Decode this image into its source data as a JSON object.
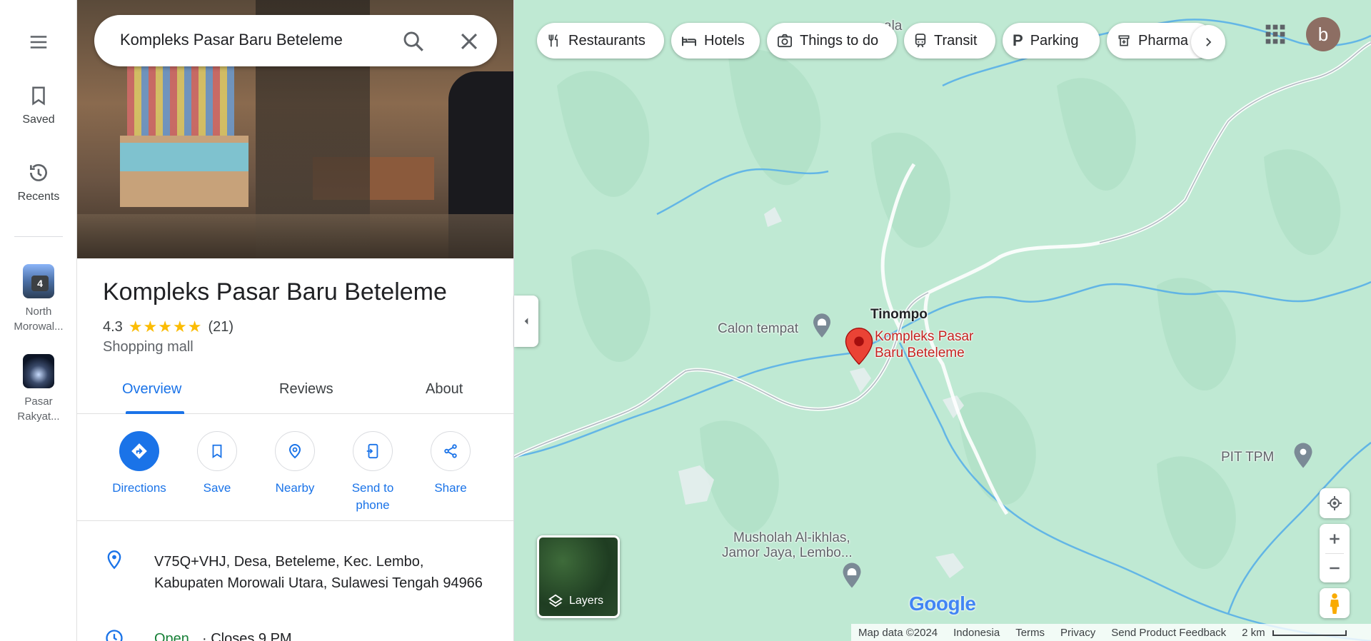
{
  "search": {
    "value": "Kompleks Pasar Baru Beteleme"
  },
  "rail": {
    "saved": "Saved",
    "recents": "Recents",
    "history": [
      {
        "label": "North Morowal...",
        "badge": "4"
      },
      {
        "label": "Pasar Rakyat..."
      }
    ]
  },
  "place": {
    "title": "Kompleks Pasar Baru Beteleme",
    "rating": "4.3",
    "stars": "★★★★★",
    "review_count": "(21)",
    "category": "Shopping mall",
    "address": "V75Q+VHJ, Desa, Beteleme, Kec. Lembo, Kabupaten Morowali Utara, Sulawesi Tengah 94966",
    "hours_status": "Open",
    "hours_detail": "· Closes 9 PM"
  },
  "tabs": [
    "Overview",
    "Reviews",
    "About"
  ],
  "actions": [
    {
      "label": "Directions"
    },
    {
      "label": "Save"
    },
    {
      "label": "Nearby"
    },
    {
      "label": "Send to phone"
    },
    {
      "label": "Share"
    }
  ],
  "chips": [
    "Restaurants",
    "Hotels",
    "Things to do",
    "Transit",
    "Parking",
    "Pharma"
  ],
  "avatar_letter": "b",
  "map": {
    "labels": {
      "top_partial": "ala",
      "calon": "Calon tempat",
      "tinompo": "Tinompo",
      "place_marker": "Kompleks Pasar Baru Beteleme",
      "pit": "PIT TPM",
      "musholah_1": "Musholah Al-ikhlas,",
      "musholah_2": "Jamor Jaya, Lembo..."
    },
    "layers": "Layers",
    "logo": "Google"
  },
  "footer": {
    "map_data": "Map data ©2024",
    "country": "Indonesia",
    "terms": "Terms",
    "privacy": "Privacy",
    "feedback": "Send Product Feedback",
    "scale": "2 km"
  },
  "colors": {
    "accent": "#1a73e8",
    "map_bg": "#bfe9d3",
    "marker": "#ea4335",
    "star": "#fbbc04",
    "open": "#188038"
  }
}
